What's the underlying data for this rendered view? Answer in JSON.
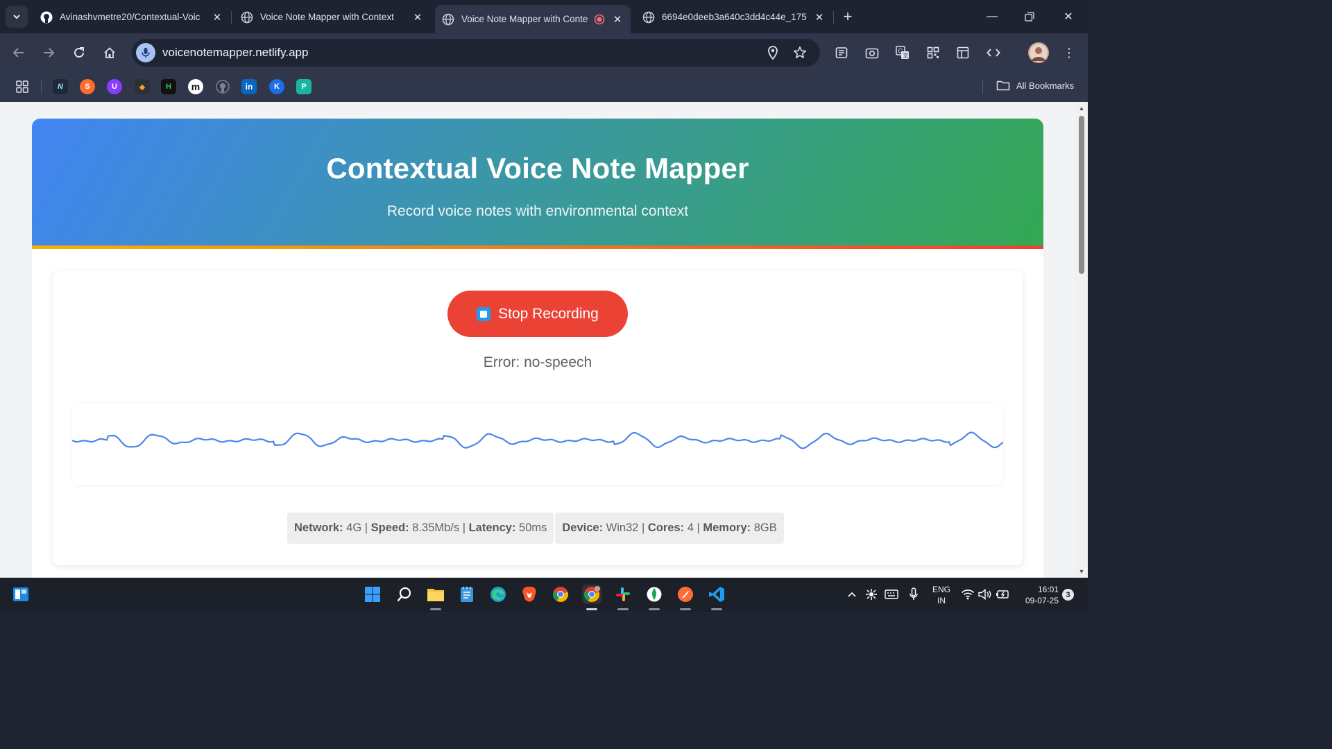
{
  "browser": {
    "tabs": [
      {
        "title": "Avinashvmetre20/Contextual-Voic",
        "icon": "github-icon",
        "active": false
      },
      {
        "title": "Voice Note Mapper with Context",
        "icon": "globe-icon",
        "active": false
      },
      {
        "title": "Voice Note Mapper with Conte",
        "icon": "globe-icon",
        "active": true,
        "recording": true
      },
      {
        "title": "6694e0deeb3a640c3dd4c44e_175",
        "icon": "globe-icon",
        "active": false
      }
    ],
    "url": "voicenotemapper.netlify.app",
    "all_bookmarks_label": "All Bookmarks",
    "bookmarks": [
      {
        "name": "apps-grid-icon"
      },
      {
        "name": "bookmark-n-icon",
        "glyph": "N",
        "color": "#1c2a3a"
      },
      {
        "name": "bookmark-s-icon",
        "glyph": "S",
        "color": "#ff6b2c"
      },
      {
        "name": "bookmark-u-icon",
        "glyph": "U",
        "color": "#8b3dff"
      },
      {
        "name": "bookmark-coding-icon",
        "glyph": "◆",
        "color": "#2c2f36"
      },
      {
        "name": "bookmark-hackerrank-icon",
        "glyph": "H",
        "color": "#111111"
      },
      {
        "name": "bookmark-medium-icon",
        "glyph": "m",
        "color": "#ffffff"
      },
      {
        "name": "bookmark-github-icon",
        "glyph": "",
        "color": "#30374b"
      },
      {
        "name": "bookmark-linkedin-icon",
        "glyph": "in",
        "color": "#0a66c2"
      },
      {
        "name": "bookmark-k-icon",
        "glyph": "K",
        "color": "#1d6fe8"
      },
      {
        "name": "bookmark-p-icon",
        "glyph": "P",
        "color": "#18b6a1"
      }
    ]
  },
  "app": {
    "title": "Contextual Voice Note Mapper",
    "subtitle": "Record voice notes with environmental context",
    "record_button_label": "Stop Recording",
    "status_text": "Error: no-speech",
    "network_info": {
      "network_label": "Network:",
      "network_value": " 4G | ",
      "speed_label": "Speed:",
      "speed_value": " 8.35Mb/s | ",
      "latency_label": "Latency:",
      "latency_value": " 50ms"
    },
    "device_info": {
      "device_label": "Device:",
      "device_value": " Win32 | ",
      "cores_label": "Cores:",
      "cores_value": " 4 | ",
      "memory_label": "Memory:",
      "memory_value": " 8GB"
    }
  },
  "taskbar": {
    "lang_top": "ENG",
    "lang_bottom": "IN",
    "time": "16:01",
    "date": "09-07-25",
    "notification_count": "3"
  },
  "colors": {
    "header_gradient_start": "#4285f4",
    "header_gradient_end": "#34a853",
    "record_button": "#ea4335",
    "wave": "#4a86e8"
  }
}
